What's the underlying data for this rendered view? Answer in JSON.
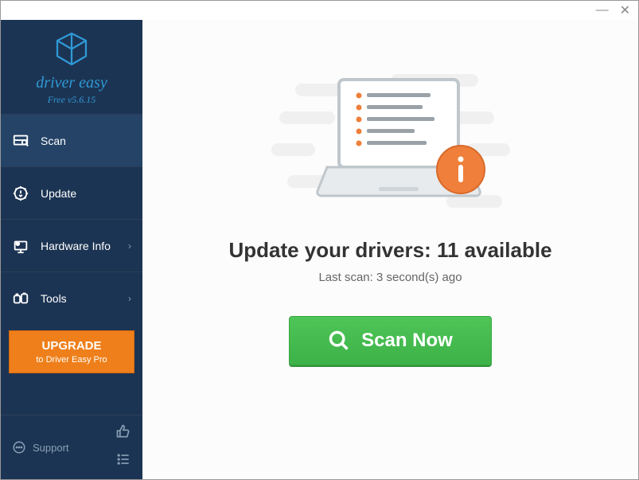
{
  "brand": {
    "name": "driver easy",
    "version": "Free v5.6.15"
  },
  "sidebar": {
    "items": [
      {
        "label": "Scan"
      },
      {
        "label": "Update"
      },
      {
        "label": "Hardware Info"
      },
      {
        "label": "Tools"
      }
    ],
    "upgrade": {
      "line1": "UPGRADE",
      "line2": "to Driver Easy Pro"
    },
    "support": "Support"
  },
  "main": {
    "headline": "Update your drivers: 11 available",
    "subline": "Last scan: 3 second(s) ago",
    "scan_button": "Scan Now"
  }
}
